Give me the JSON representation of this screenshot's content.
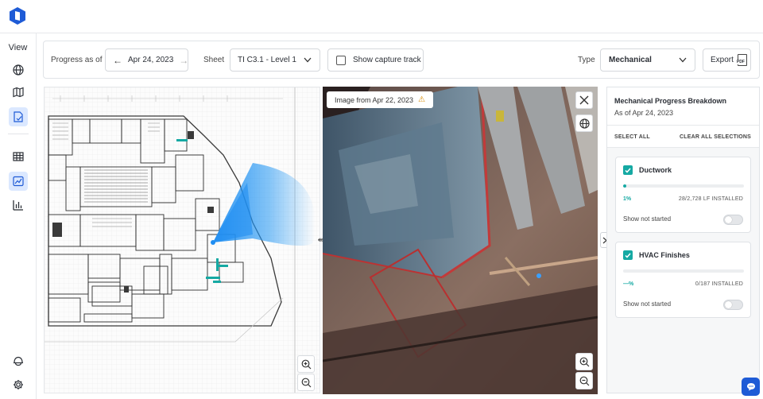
{
  "colors": {
    "brand": "#1e5bd6",
    "accent_teal": "#15a9a3",
    "coverage_blue": "#2196f3",
    "warning": "#d88a00"
  },
  "sidebar": {
    "view_label": "View",
    "items": [
      {
        "icon": "globe-icon",
        "active": false
      },
      {
        "icon": "map-icon",
        "active": false
      },
      {
        "icon": "progress-sheet-icon",
        "active": true
      },
      {
        "icon": "table-icon",
        "active": false
      },
      {
        "icon": "map-compare-icon",
        "active": true
      },
      {
        "icon": "bar-chart-icon",
        "active": false
      }
    ],
    "bottom_items": [
      {
        "icon": "hard-hat-icon"
      },
      {
        "icon": "gear-icon"
      }
    ]
  },
  "toolbar": {
    "progress_label": "Progress as of",
    "date": "Apr 24, 2023",
    "sheet_label": "Sheet",
    "sheet_value": "TI C3.1 - Level 1",
    "capture_track_label": "Show capture track",
    "capture_track_checked": false,
    "type_label": "Type",
    "type_value": "Mechanical",
    "export_label": "Export",
    "export_badge": "PDF"
  },
  "viewer": {
    "image_badge": "Image from Apr 22, 2023",
    "warning_symbol": "⚠"
  },
  "panel": {
    "title": "Mechanical Progress Breakdown",
    "subtitle": "As of Apr 24, 2023",
    "select_all": "SELECT ALL",
    "clear_all": "CLEAR ALL SELECTIONS",
    "cards": [
      {
        "name": "Ductwork",
        "checked": true,
        "percent_label": "1%",
        "progress": 0.01,
        "installed": "28/2,728 LF INSTALLED",
        "show_not_started": "Show not started",
        "toggle_on": false
      },
      {
        "name": "HVAC Finishes",
        "checked": true,
        "percent_label": "—%",
        "progress": 0,
        "installed": "0/187 INSTALLED",
        "show_not_started": "Show not started",
        "toggle_on": false
      }
    ]
  }
}
